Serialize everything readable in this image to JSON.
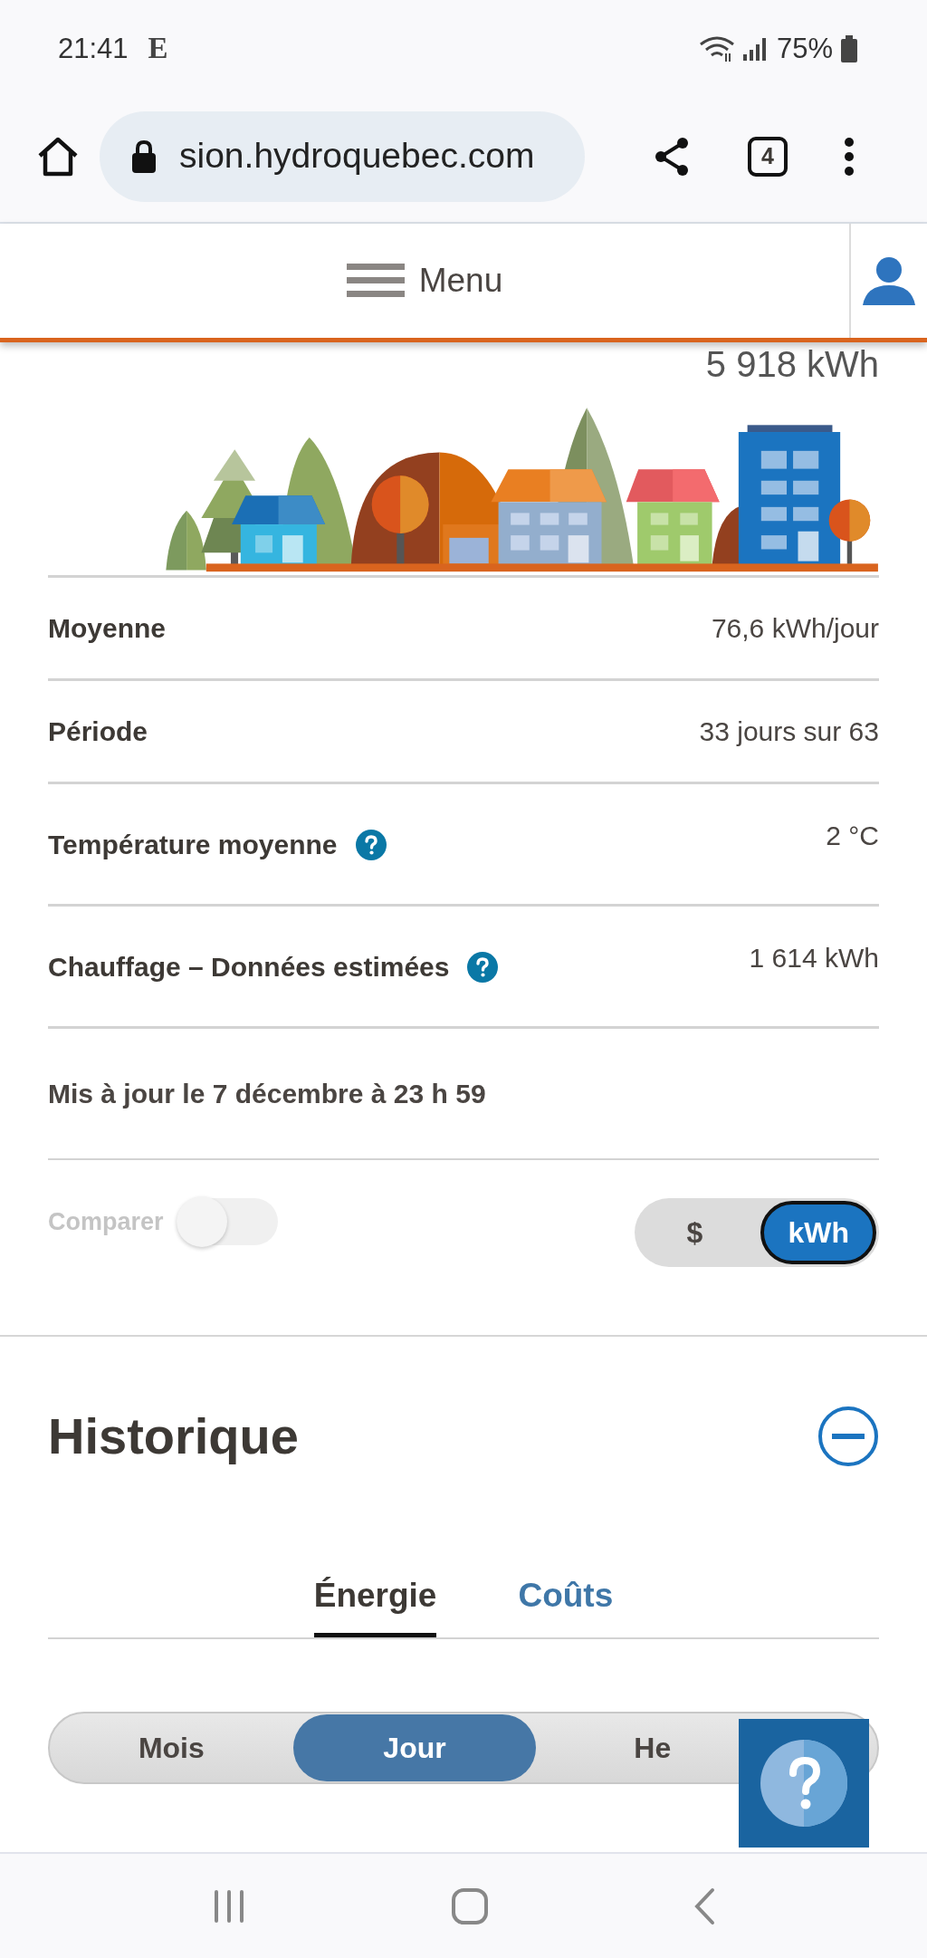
{
  "status_bar": {
    "time": "21:41",
    "notification": "E",
    "battery": "75%"
  },
  "browser": {
    "url": "sion.hydroquebec.com",
    "tab_count": "4"
  },
  "header": {
    "menu_label": "Menu"
  },
  "summary": {
    "total": "5 918 kWh",
    "stats": [
      {
        "label": "Moyenne",
        "value": "76,6 kWh/jour",
        "help": false
      },
      {
        "label": "Période",
        "value": "33 jours sur 63",
        "help": false
      },
      {
        "label": "Température moyenne",
        "value": "2 °C",
        "help": true
      },
      {
        "label": "Chauffage – Données estimées",
        "value": "1 614 kWh",
        "help": true
      }
    ],
    "updated": "Mis à jour le 7 décembre à 23 h 59"
  },
  "compare": {
    "label": "Comparer",
    "on": false
  },
  "unit_toggle": [
    {
      "label": "$",
      "selected": false
    },
    {
      "label": "kWh",
      "selected": true
    }
  ],
  "history": {
    "title": "Historique",
    "expanded": true,
    "tabs": [
      {
        "label": "Énergie",
        "selected": true
      },
      {
        "label": "Coûts",
        "selected": false
      }
    ],
    "periods": [
      {
        "label": "Mois",
        "selected": false
      },
      {
        "label": "Jour",
        "selected": true
      },
      {
        "label": "He",
        "selected": false
      }
    ]
  }
}
